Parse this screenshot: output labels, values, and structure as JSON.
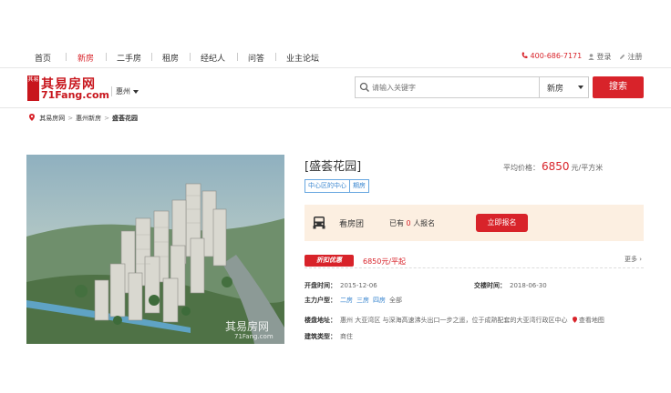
{
  "nav": {
    "items": [
      {
        "label": "首页",
        "active": false
      },
      {
        "label": "新房",
        "active": true
      },
      {
        "label": "二手房",
        "active": false
      },
      {
        "label": "租房",
        "active": false
      },
      {
        "label": "经纪人",
        "active": false
      },
      {
        "label": "问答",
        "active": false
      },
      {
        "label": "业主论坛",
        "active": false
      }
    ],
    "phone": "400-686-7171",
    "login": "登录",
    "register": "注册"
  },
  "header": {
    "logo_mark": "其易",
    "logo_cn": "其易房网",
    "logo_en": "71Fang.com",
    "city": "惠州",
    "search_placeholder": "请输入关键字",
    "search_type": "新房",
    "search_button": "搜索"
  },
  "breadcrumb": {
    "items": [
      "其易房网",
      "惠州新房",
      "盛荟花园"
    ]
  },
  "hero": {
    "watermark_cn": "其易房网",
    "watermark_en": "71Fang.com"
  },
  "listing": {
    "title": "[盛荟花园]",
    "avg_label": "平均价格：",
    "avg_value": "6850",
    "avg_unit": "元/平方米",
    "tags": [
      "中心区的中心",
      "期房"
    ],
    "group": {
      "label": "看房团",
      "count_prefix": "已有",
      "count": "0",
      "count_suffix": "人报名",
      "signup_button": "立即报名"
    },
    "discount": {
      "badge": "折扣优惠",
      "price": "6850元/平起",
      "more": "更多"
    },
    "open_date_label": "开盘时间：",
    "open_date": "2015-12-06",
    "deliver_label": "交楼时间：",
    "deliver_date": "2018-06-30",
    "layout_label": "主力户型：",
    "layouts": [
      "二房",
      "三房",
      "四房"
    ],
    "layouts_all": "全部",
    "address_label": "楼盘地址：",
    "address": "惠州 大亚湾区 与深海高速沸头出口一步之遥，位于成熟配套的大亚湾行政区中心",
    "map_link": "查看地图",
    "type_label": "建筑类型：",
    "type_value": "商住"
  },
  "colors": {
    "brand_red": "#d8232a",
    "link_blue": "#3b87d0",
    "group_bg": "#fcefe1"
  }
}
